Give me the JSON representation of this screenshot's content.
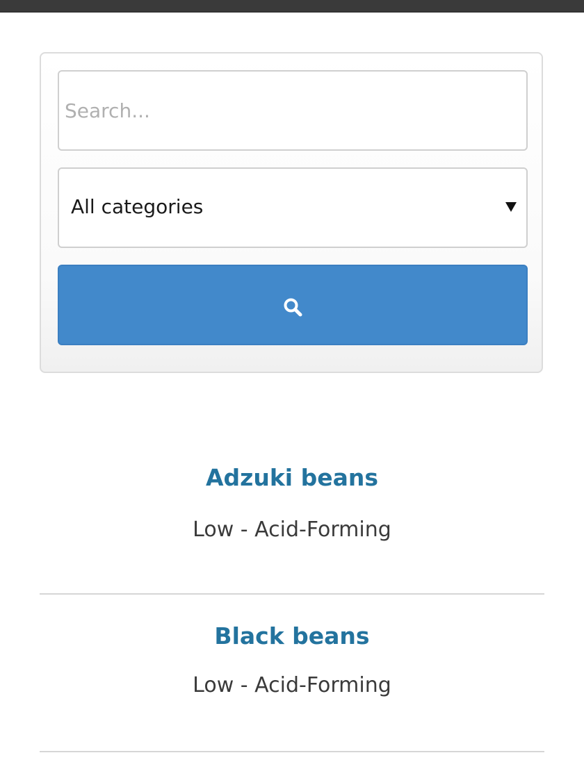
{
  "search": {
    "placeholder": "Search...",
    "value": ""
  },
  "category": {
    "selected": "All categories"
  },
  "search_button": {
    "icon": "search-icon",
    "color": "#4289cb"
  },
  "results": [
    {
      "title": "Adzuki beans",
      "level": "Low - Acid-Forming"
    },
    {
      "title": "Black beans",
      "level": "Low - Acid-Forming"
    }
  ],
  "colors": {
    "title_link": "#23739e",
    "top_bar": "#3a3a3a"
  }
}
